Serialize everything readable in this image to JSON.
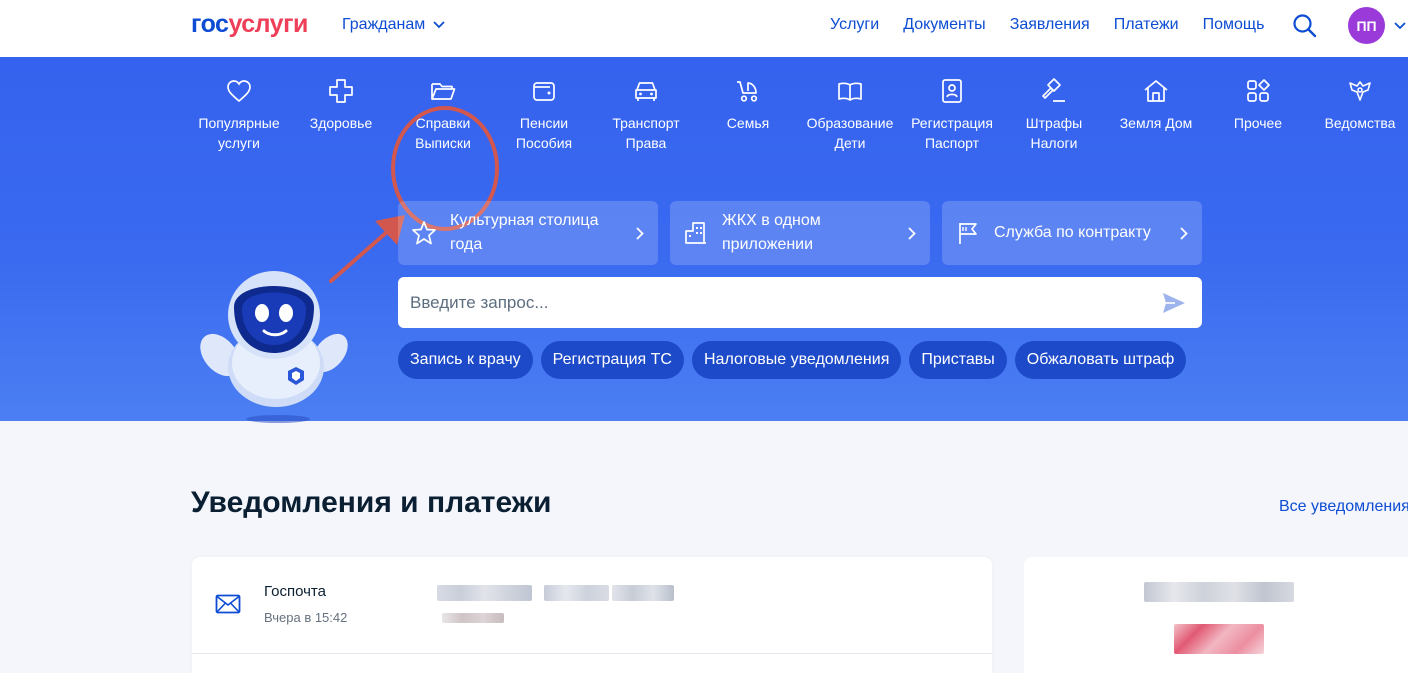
{
  "header": {
    "logo_part1": "гос",
    "logo_part2": "услуги",
    "audience": "Гражданам",
    "nav": [
      "Услуги",
      "Документы",
      "Заявления",
      "Платежи",
      "Помощь"
    ],
    "avatar_initials": "ПП"
  },
  "categories": [
    {
      "label": "Популярные\nуслуги",
      "icon": "heart-icon"
    },
    {
      "label": "Здоровье",
      "icon": "medical-cross-icon"
    },
    {
      "label": "Справки\nВыписки",
      "icon": "folder-icon"
    },
    {
      "label": "Пенсии\nПособия",
      "icon": "wallet-icon"
    },
    {
      "label": "Транспорт\nПрава",
      "icon": "car-icon"
    },
    {
      "label": "Семья",
      "icon": "stroller-icon"
    },
    {
      "label": "Образование\nДети",
      "icon": "book-icon"
    },
    {
      "label": "Регистрация\nПаспорт",
      "icon": "passport-icon"
    },
    {
      "label": "Штрафы\nНалоги",
      "icon": "gavel-icon"
    },
    {
      "label": "Земля Дом",
      "icon": "house-icon"
    },
    {
      "label": "Прочее",
      "icon": "grid-icon"
    },
    {
      "label": "Ведомства",
      "icon": "emblem-icon"
    }
  ],
  "promos": [
    {
      "label": "Культурная столица года",
      "icon": "star-icon"
    },
    {
      "label": "ЖКХ в одном приложении",
      "icon": "building-icon"
    },
    {
      "label": "Служба по контракту",
      "icon": "flag-icon"
    }
  ],
  "search": {
    "placeholder": "Введите запрос..."
  },
  "chips": [
    "Запись к врачу",
    "Регистрация ТС",
    "Налоговые уведомления",
    "Приставы",
    "Обжаловать штраф"
  ],
  "notifications": {
    "title": "Уведомления и платежи",
    "all_link": "Все уведомления",
    "items": [
      {
        "sender": "Госпочта",
        "time": "Вчера в 15:42"
      }
    ]
  },
  "colors": {
    "brand_blue": "#0d4cd3",
    "brand_red": "#ee3f58",
    "hero_blue": "#3a6af0",
    "chip_blue": "#1d4ac8",
    "annotation_red": "#d2574e",
    "avatar_purple": "#9a3ad8"
  }
}
